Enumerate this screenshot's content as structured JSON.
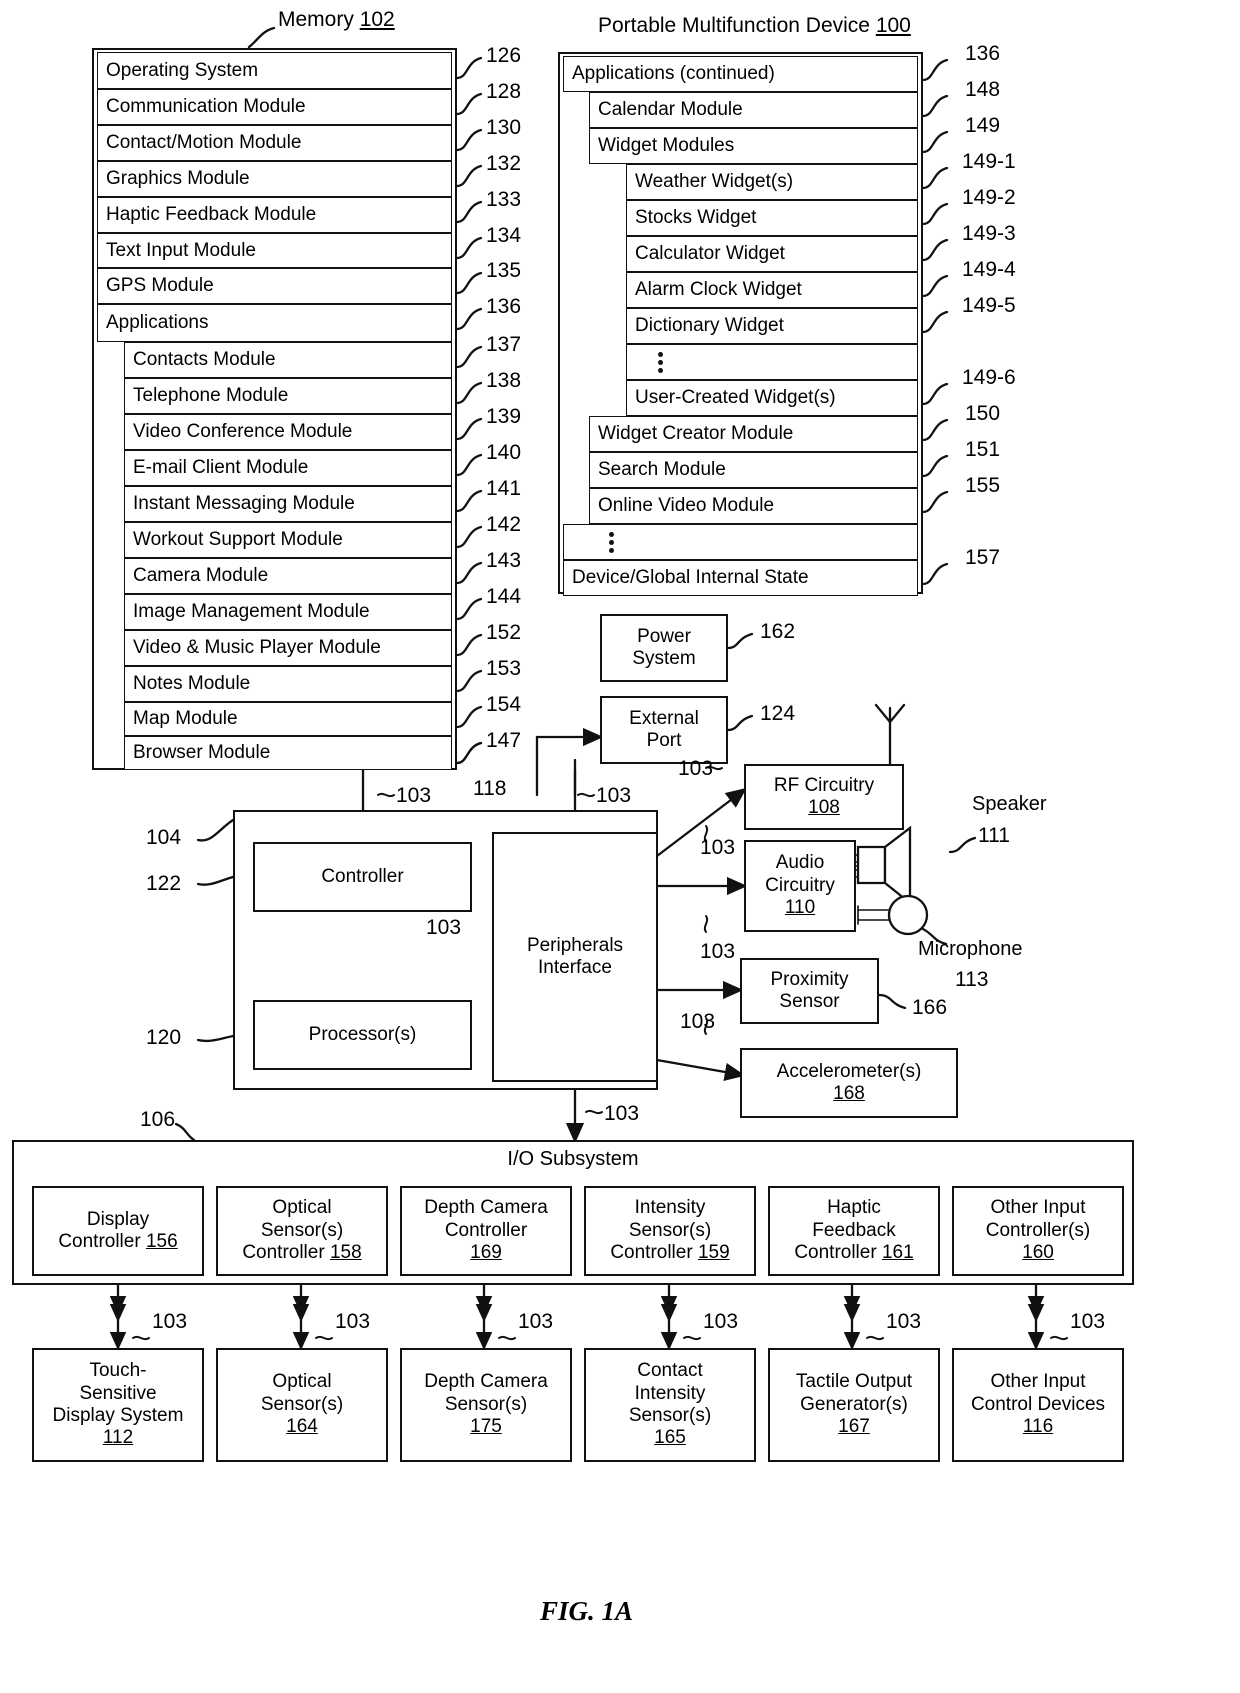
{
  "figure": {
    "caption": "FIG. 1A"
  },
  "memory": {
    "title_text": "Memory",
    "title_ref": "102",
    "items": [
      {
        "label": "Operating System",
        "ref": "126"
      },
      {
        "label": "Communication Module",
        "ref": "128"
      },
      {
        "label": "Contact/Motion Module",
        "ref": "130"
      },
      {
        "label": "Graphics Module",
        "ref": "132"
      },
      {
        "label": "Haptic Feedback Module",
        "ref": "133"
      },
      {
        "label": "Text Input Module",
        "ref": "134"
      },
      {
        "label": "GPS Module",
        "ref": "135"
      },
      {
        "label": "Applications",
        "ref": "136"
      }
    ],
    "applications": [
      {
        "label": "Contacts Module",
        "ref": "137"
      },
      {
        "label": "Telephone Module",
        "ref": "138"
      },
      {
        "label": "Video Conference Module",
        "ref": "139"
      },
      {
        "label": "E-mail Client Module",
        "ref": "140"
      },
      {
        "label": "Instant Messaging Module",
        "ref": "141"
      },
      {
        "label": "Workout Support Module",
        "ref": "142"
      },
      {
        "label": "Camera Module",
        "ref": "143"
      },
      {
        "label": "Image Management Module",
        "ref": "144"
      },
      {
        "label": "Video & Music Player Module",
        "ref": "152"
      },
      {
        "label": "Notes Module",
        "ref": "153"
      },
      {
        "label": "Map Module",
        "ref": "154"
      },
      {
        "label": "Browser Module",
        "ref": "147"
      }
    ]
  },
  "device": {
    "title_text": "Portable Multifunction Device",
    "title_ref": "100",
    "applications_continued": {
      "label": "Applications (continued)",
      "ref": "136"
    },
    "modules": [
      {
        "label": "Calendar Module",
        "ref": "148"
      },
      {
        "label": "Widget Modules",
        "ref": "149"
      }
    ],
    "widgets": [
      {
        "label": "Weather Widget(s)",
        "ref": "149-1"
      },
      {
        "label": "Stocks Widget",
        "ref": "149-2"
      },
      {
        "label": "Calculator Widget",
        "ref": "149-3"
      },
      {
        "label": "Alarm Clock Widget",
        "ref": "149-4"
      },
      {
        "label": "Dictionary Widget",
        "ref": "149-5"
      },
      {
        "label": "",
        "ref": ""
      },
      {
        "label": "User-Created Widget(s)",
        "ref": "149-6"
      }
    ],
    "modules_after": [
      {
        "label": "Widget Creator Module",
        "ref": "150"
      },
      {
        "label": "Search Module",
        "ref": "151"
      },
      {
        "label": "Online Video Module",
        "ref": "155"
      }
    ],
    "internal_state": {
      "label": "Device/Global Internal State",
      "ref": "157"
    }
  },
  "power": {
    "line1": "Power",
    "line2": "System",
    "ref": "162"
  },
  "external_port": {
    "line1": "External",
    "line2": "Port",
    "ref": "124"
  },
  "cpu_block": {
    "ref_outer": "104",
    "ref_controller": "122",
    "ref_processor": "120",
    "controller_label": "Controller",
    "processor_label": "Processor(s)",
    "peripherals_line1": "Peripherals",
    "peripherals_line2": "Interface",
    "ref_peripherals": "118",
    "bus_ref": "103"
  },
  "peripherals": [
    {
      "line1": "RF Circuitry",
      "num": "108"
    },
    {
      "line1": "Audio",
      "line2": "Circuitry",
      "num": "110"
    },
    {
      "line1": "Proximity",
      "line2": "Sensor",
      "num": "",
      "ref": "166"
    },
    {
      "line1": "Accelerometer(s)",
      "num": "168"
    }
  ],
  "speaker": {
    "label": "Speaker",
    "ref": "111"
  },
  "microphone": {
    "label": "Microphone",
    "ref": "113"
  },
  "io_subsystem": {
    "title": "I/O Subsystem",
    "ref": "106"
  },
  "controllers": [
    {
      "lines": [
        "Display",
        "Controller"
      ],
      "num": "156",
      "num_underline": true,
      "inline": true
    },
    {
      "lines": [
        "Optical",
        "Sensor(s)",
        "Controller"
      ],
      "num": "158",
      "num_underline": true,
      "inline": true
    },
    {
      "lines": [
        "Depth Camera",
        "Controller"
      ],
      "num": "169",
      "num_underline": true,
      "inline": false
    },
    {
      "lines": [
        "Intensity",
        "Sensor(s)",
        "Controller"
      ],
      "num": "159",
      "num_underline": true,
      "inline": true
    },
    {
      "lines": [
        "Haptic",
        "Feedback",
        "Controller"
      ],
      "num": "161",
      "num_underline": true,
      "inline": true
    },
    {
      "lines": [
        "Other Input",
        "Controller(s)"
      ],
      "num": "160",
      "num_underline": true,
      "inline": false
    }
  ],
  "devices": [
    {
      "lines": [
        "Touch-",
        "Sensitive",
        "Display System"
      ],
      "num": "112",
      "num_underline": true
    },
    {
      "lines": [
        "Optical",
        "Sensor(s)"
      ],
      "num": "164",
      "num_underline": true
    },
    {
      "lines": [
        "Depth Camera",
        "Sensor(s)"
      ],
      "num": "175",
      "num_underline": true
    },
    {
      "lines": [
        "Contact",
        "Intensity",
        "Sensor(s)"
      ],
      "num": "165",
      "num_underline": true
    },
    {
      "lines": [
        "Tactile Output",
        "Generator(s)"
      ],
      "num": "167",
      "num_underline": true
    },
    {
      "lines": [
        "Other Input",
        "Control Devices"
      ],
      "num": "116",
      "num_underline": true
    }
  ],
  "bus_labels": {
    "b103": "103"
  }
}
